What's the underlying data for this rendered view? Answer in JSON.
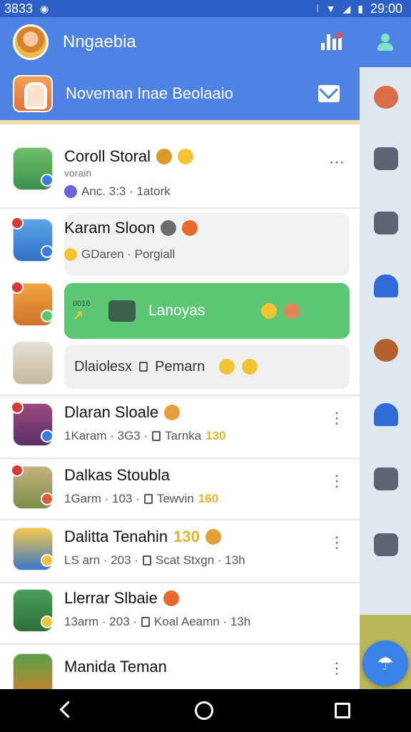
{
  "status_bar": {
    "left_text": "3833",
    "time": "29:00"
  },
  "app_bar": {
    "title": "Nngaebia",
    "icons": [
      "chart-icon",
      "person-icon"
    ]
  },
  "sub_header": {
    "title": "Noveman Inae Beolaaio",
    "icon": "mail-icon"
  },
  "rows": [
    {
      "name": "Coroll Storal",
      "name_small": "vorain",
      "meta": "Anc. 3:3 · 1atork",
      "style": "plain"
    },
    {
      "name": "Karam Sloon",
      "meta": "GDaren · Porgiall",
      "style": "highlight"
    },
    {
      "card_label": "Lanoyas",
      "card_code": "0016",
      "style": "green-card"
    },
    {
      "card_label": "Dlaiolesx",
      "card_label_2": "Pemarn",
      "style": "gray-card"
    },
    {
      "name": "Dlaran Sloale",
      "meta_left": "1Karam · 3G3 ·",
      "meta_right": "Tarnka",
      "meta_num": "130",
      "style": "plain"
    },
    {
      "name": "Dalkas Stoubla",
      "meta_left": "1Garm · 103 ·",
      "meta_right": "Tewvin",
      "meta_num": "160",
      "style": "plain"
    },
    {
      "name": "Dalitta Tenahin",
      "name_num": "130",
      "meta_left": "LS arn · 203 ·",
      "meta_right": "Scat Stxgn · 13h",
      "style": "plain"
    },
    {
      "name": "Llerrar Slbaie",
      "meta_left": "13arm · 203 ·",
      "meta_right": "Koal Aeamn · 13h",
      "style": "plain"
    },
    {
      "name": "Manida Teman",
      "style": "plain"
    }
  ],
  "colors": {
    "primary": "#4e82e3",
    "status": "#2d5fc7",
    "green": "#5cc675",
    "fab": "#3b82e6"
  },
  "nav": [
    "back-icon",
    "home-icon",
    "recents-icon"
  ]
}
